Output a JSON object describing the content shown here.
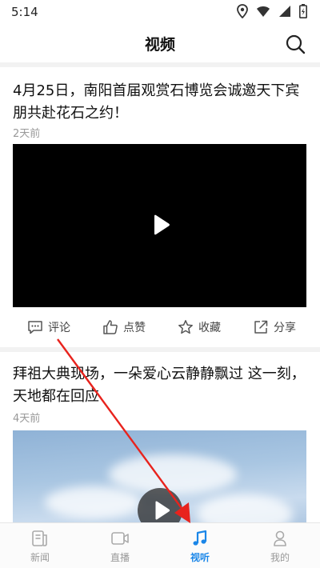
{
  "status_bar": {
    "time": "5:14",
    "icons": [
      "location-icon",
      "wifi-icon",
      "signal-icon",
      "battery-icon"
    ]
  },
  "header": {
    "title": "视频",
    "search_icon": "search-icon"
  },
  "feed": [
    {
      "title": "4月25日，南阳首届观赏石博览会诚邀天下宾朋共赴花石之约！",
      "time": "2天前",
      "actions": [
        {
          "label": "评论",
          "icon": "comment-icon"
        },
        {
          "label": "点赞",
          "icon": "thumbs-up-icon"
        },
        {
          "label": "收藏",
          "icon": "star-icon"
        },
        {
          "label": "分享",
          "icon": "share-icon"
        }
      ]
    },
    {
      "title": "拜祖大典现场，一朵爱心云静静飘过 这一刻，天地都在回应",
      "time": "4天前"
    }
  ],
  "tabbar": {
    "tabs": [
      {
        "label": "新闻",
        "icon": "news-icon"
      },
      {
        "label": "直播",
        "icon": "live-icon"
      },
      {
        "label": "视听",
        "icon": "music-note-icon",
        "active": true
      },
      {
        "label": "我的",
        "icon": "profile-icon"
      }
    ]
  },
  "colors": {
    "accent": "#1a86e8",
    "annotation_arrow": "#e8231d"
  }
}
